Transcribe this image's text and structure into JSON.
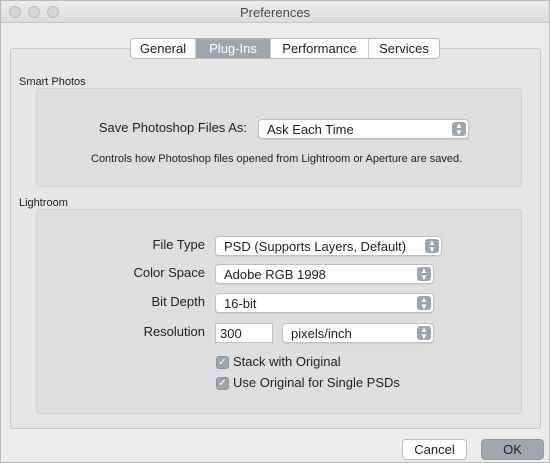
{
  "window": {
    "title": "Preferences"
  },
  "tabs": [
    {
      "label": "General",
      "active": false
    },
    {
      "label": "Plug-Ins",
      "active": true
    },
    {
      "label": "Performance",
      "active": false
    },
    {
      "label": "Services",
      "active": false
    }
  ],
  "smart_photos": {
    "section_label": "Smart Photos",
    "save_as_label": "Save Photoshop Files As:",
    "save_as_value": "Ask Each Time",
    "help_text": "Controls how Photoshop files opened from Lightroom or Aperture are saved."
  },
  "lightroom": {
    "section_label": "Lightroom",
    "file_type_label": "File Type",
    "file_type_value": "PSD (Supports Layers, Default)",
    "color_space_label": "Color Space",
    "color_space_value": "Adobe RGB 1998",
    "bit_depth_label": "Bit Depth",
    "bit_depth_value": "16-bit",
    "resolution_label": "Resolution",
    "resolution_value": "300",
    "resolution_unit": "pixels/inch",
    "stack_with_original_label": "Stack with Original",
    "stack_with_original_checked": true,
    "use_original_label": "Use Original for Single PSDs",
    "use_original_checked": true
  },
  "buttons": {
    "cancel": "Cancel",
    "ok": "OK"
  },
  "icons": {
    "checkmark": "✓",
    "stepper_up": "▲",
    "stepper_down": "▼"
  },
  "colors": {
    "accent": "#9da6b0",
    "window_bg": "#ececec",
    "group_bg": "#dedede"
  }
}
